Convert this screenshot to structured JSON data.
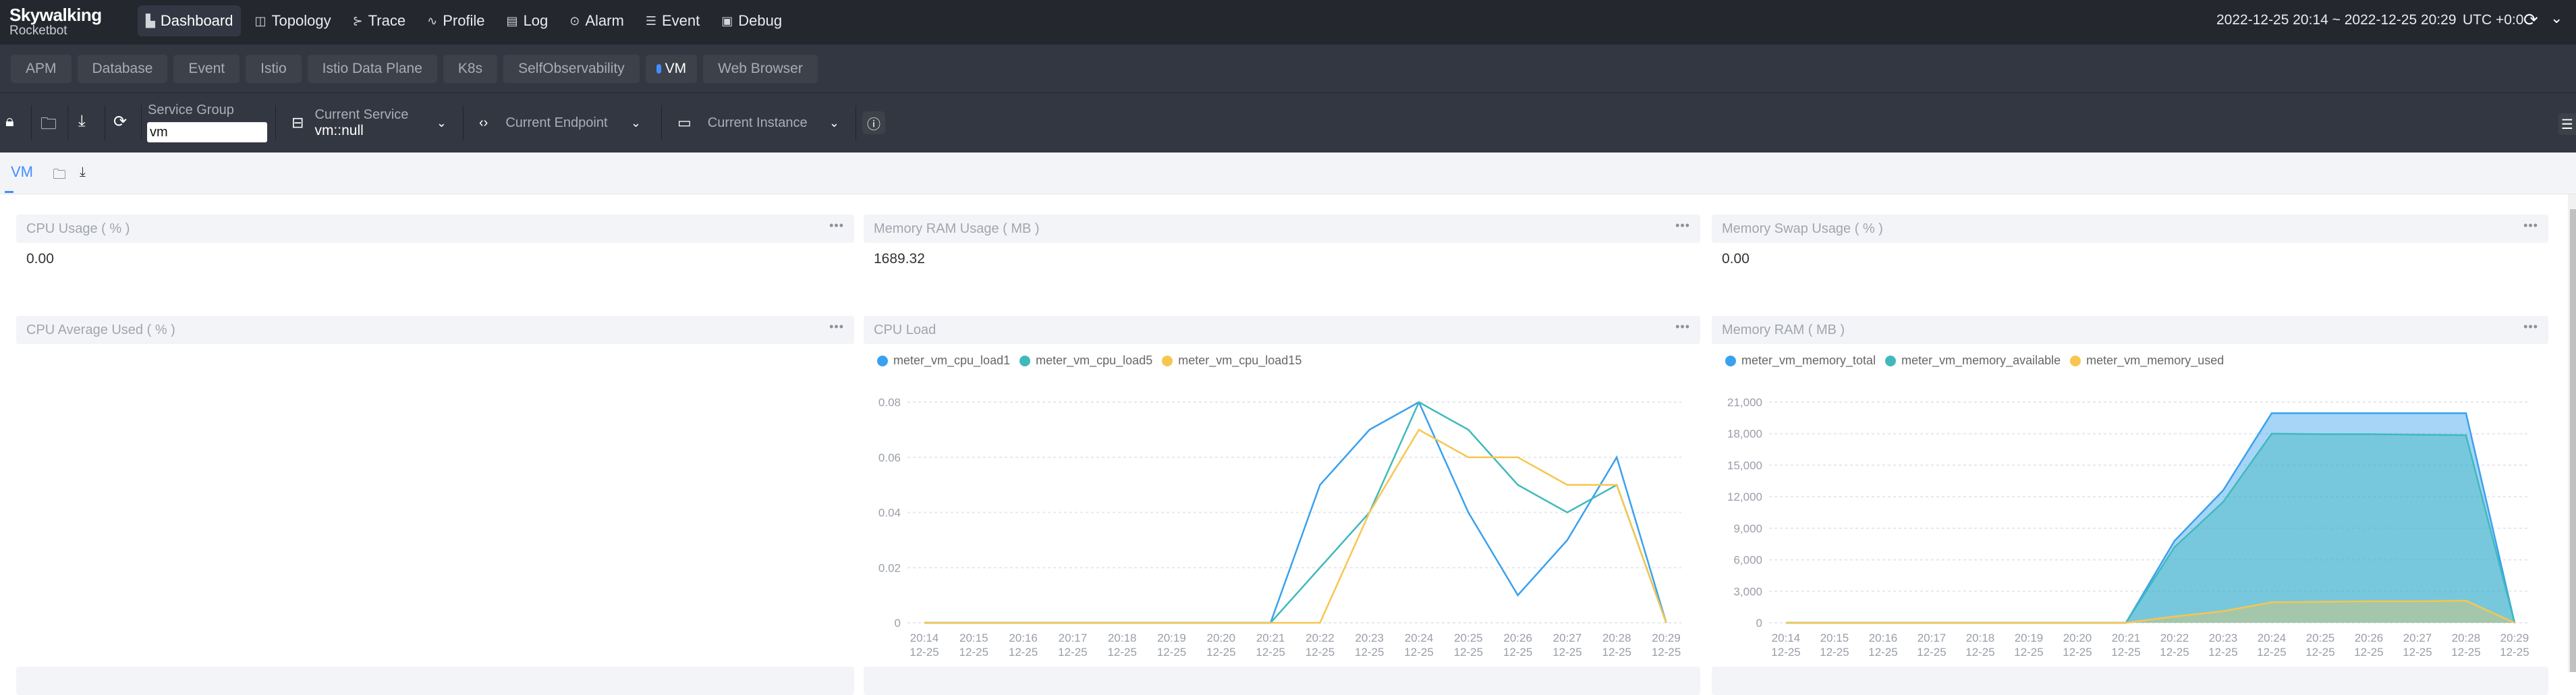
{
  "app": {
    "logo_title": "Skywalking",
    "logo_subtitle": "Rocketbot"
  },
  "nav": {
    "items": [
      {
        "label": "Dashboard",
        "icon": "dashboard-icon",
        "glyph": "▙",
        "active": true
      },
      {
        "label": "Topology",
        "icon": "topology-icon",
        "glyph": "◫",
        "active": false
      },
      {
        "label": "Trace",
        "icon": "trace-icon",
        "glyph": "⊱",
        "active": false
      },
      {
        "label": "Profile",
        "icon": "profile-icon",
        "glyph": "∿",
        "active": false
      },
      {
        "label": "Log",
        "icon": "log-icon",
        "glyph": "▤",
        "active": false
      },
      {
        "label": "Alarm",
        "icon": "alarm-icon",
        "glyph": "⊙",
        "active": false
      },
      {
        "label": "Event",
        "icon": "event-icon",
        "glyph": "☰",
        "active": false
      },
      {
        "label": "Debug",
        "icon": "debug-icon",
        "glyph": "▣",
        "active": false
      }
    ],
    "time_range": "2022-12-25 20:14 ~ 2022-12-25 20:29",
    "timezone": "UTC +0:0",
    "refresh_glyph": "⟳",
    "chevron_glyph": "⌄"
  },
  "layers": {
    "items": [
      {
        "label": "APM",
        "active": false
      },
      {
        "label": "Database",
        "active": false
      },
      {
        "label": "Event",
        "active": false
      },
      {
        "label": "Istio",
        "active": false
      },
      {
        "label": "Istio Data Plane",
        "active": false
      },
      {
        "label": "K8s",
        "active": false
      },
      {
        "label": "SelfObservability",
        "active": false
      },
      {
        "label": "VM",
        "active": true
      },
      {
        "label": "Web Browser",
        "active": false
      }
    ],
    "active_color": "#448dfe"
  },
  "toolbar": {
    "service_group_label": "Service Group",
    "service_group_value": "vm",
    "current_service_label": "Current Service",
    "current_service_value": "vm::null",
    "current_endpoint_label": "Current Endpoint",
    "current_instance_label": "Current Instance",
    "info_glyph": "ⓘ",
    "lock_glyph": "🔒︎",
    "folder_glyph": "🗀",
    "download_glyph": "⤓",
    "refresh_glyph": "⟳",
    "endpoint_glyph": "‹›",
    "instance_glyph": "▭",
    "service_glyph": "⊟",
    "chevron_glyph": "⌄",
    "toggle_glyph": "☰"
  },
  "dashboard_tabs": {
    "active": "VM",
    "folder_glyph": "🗀",
    "download_glyph": "⤓"
  },
  "widgets": {
    "cpu_usage": {
      "title": "CPU Usage ( % )",
      "value": "0.00"
    },
    "memory_ram_usage": {
      "title": "Memory RAM Usage ( MB )",
      "value": "1689.32"
    },
    "memory_swap_usage": {
      "title": "Memory Swap Usage ( % )",
      "value": "0.00"
    },
    "cpu_average_used": {
      "title": "CPU Average Used ( % )"
    },
    "cpu_load": {
      "title": "CPU Load"
    },
    "memory_ram": {
      "title": "Memory RAM ( MB )"
    },
    "more_glyph": "•••"
  },
  "chart_data": [
    {
      "type": "line",
      "title": "CPU Load",
      "x": [
        "20:14\n12-25",
        "20:15\n12-25",
        "20:16\n12-25",
        "20:17\n12-25",
        "20:18\n12-25",
        "20:19\n12-25",
        "20:20\n12-25",
        "20:21\n12-25",
        "20:22\n12-25",
        "20:23\n12-25",
        "20:24\n12-25",
        "20:25\n12-25",
        "20:26\n12-25",
        "20:27\n12-25",
        "20:28\n12-25",
        "20:29\n12-25"
      ],
      "series": [
        {
          "name": "meter_vm_cpu_load1",
          "color": "#3aa1ee",
          "values": [
            0,
            0,
            0,
            0,
            0,
            0,
            0,
            0,
            0.05,
            0.07,
            0.08,
            0.04,
            0.01,
            0.03,
            0.06,
            0
          ]
        },
        {
          "name": "meter_vm_cpu_load5",
          "color": "#41b9bc",
          "values": [
            0,
            0,
            0,
            0,
            0,
            0,
            0,
            0,
            0.02,
            0.04,
            0.08,
            0.07,
            0.05,
            0.04,
            0.05,
            0
          ]
        },
        {
          "name": "meter_vm_cpu_load15",
          "color": "#f7c64f",
          "values": [
            0,
            0,
            0,
            0,
            0,
            0,
            0,
            0,
            0,
            0.04,
            0.07,
            0.06,
            0.06,
            0.05,
            0.05,
            0
          ]
        }
      ],
      "yticks": [
        "0",
        "0.02",
        "0.04",
        "0.06",
        "0.08"
      ],
      "ylim": [
        0,
        0.08
      ],
      "grid": true,
      "legend": "top-left"
    },
    {
      "type": "area",
      "title": "Memory RAM ( MB )",
      "x": [
        "20:14\n12-25",
        "20:15\n12-25",
        "20:16\n12-25",
        "20:17\n12-25",
        "20:18\n12-25",
        "20:19\n12-25",
        "20:20\n12-25",
        "20:21\n12-25",
        "20:22\n12-25",
        "20:23\n12-25",
        "20:24\n12-25",
        "20:25\n12-25",
        "20:26\n12-25",
        "20:27\n12-25",
        "20:28\n12-25",
        "20:29\n12-25"
      ],
      "series": [
        {
          "name": "meter_vm_memory_total",
          "color": "#3aa1ee",
          "values": [
            0,
            0,
            0,
            0,
            0,
            0,
            0,
            0,
            7800,
            12600,
            19950,
            19950,
            19950,
            19950,
            19950,
            0
          ]
        },
        {
          "name": "meter_vm_memory_available",
          "color": "#41b9bc",
          "values": [
            0,
            0,
            0,
            0,
            0,
            0,
            0,
            0,
            7200,
            11500,
            18000,
            17950,
            17950,
            17900,
            17850,
            0
          ]
        },
        {
          "name": "meter_vm_memory_used",
          "color": "#f7c64f",
          "values": [
            0,
            0,
            0,
            0,
            0,
            0,
            0,
            0,
            600,
            1100,
            1950,
            2000,
            2050,
            2050,
            2100,
            0
          ]
        }
      ],
      "yticks": [
        "0",
        "3,000",
        "6,000",
        "9,000",
        "12,000",
        "15,000",
        "18,000",
        "21,000"
      ],
      "ylim": [
        0,
        21000
      ],
      "grid": true,
      "legend": "top-left"
    }
  ]
}
